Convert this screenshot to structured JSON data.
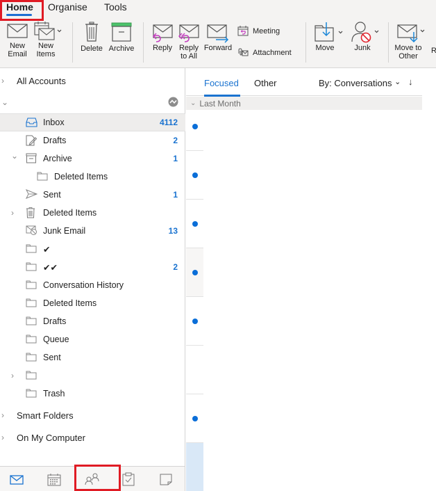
{
  "tabs": [
    {
      "label": "Home",
      "active": true
    },
    {
      "label": "Organise",
      "active": false
    },
    {
      "label": "Tools",
      "active": false
    }
  ],
  "ribbon": {
    "new_email": "New\nEmail",
    "new_email_l1": "New",
    "new_email_l2": "Email",
    "new_items_l1": "New",
    "new_items_l2": "Items",
    "delete": "Delete",
    "archive": "Archive",
    "reply": "Reply",
    "reply_all_l1": "Reply",
    "reply_all_l2": "to All",
    "forward": "Forward",
    "meeting": "Meeting",
    "attachment": "Attachment",
    "move": "Move",
    "junk": "Junk",
    "move_other_l1": "Move to",
    "move_other_l2": "Other",
    "cut_off": "R"
  },
  "sidebar": {
    "all_accounts": "All Accounts",
    "account_name": "",
    "folders": [
      {
        "label": "Inbox",
        "count": "4112",
        "icon": "inbox-icon",
        "selected": true
      },
      {
        "label": "Drafts",
        "count": "2",
        "icon": "drafts-icon"
      },
      {
        "label": "Archive",
        "count": "1",
        "icon": "archive-icon",
        "expanded": true
      },
      {
        "label": "Deleted Items",
        "count": "",
        "icon": "folder-icon",
        "indent": 2
      },
      {
        "label": "Sent",
        "count": "1",
        "icon": "sent-icon"
      },
      {
        "label": "Deleted Items",
        "count": "",
        "icon": "trash-icon",
        "collapsed": true
      },
      {
        "label": "Junk Email",
        "count": "13",
        "icon": "junk-icon"
      },
      {
        "label": "✔",
        "count": "",
        "icon": "folder-icon"
      },
      {
        "label": "✔✔",
        "count": "2",
        "icon": "folder-icon"
      },
      {
        "label": "Conversation History",
        "count": "",
        "icon": "folder-icon"
      },
      {
        "label": "Deleted Items",
        "count": "",
        "icon": "folder-icon"
      },
      {
        "label": "Drafts",
        "count": "",
        "icon": "folder-icon"
      },
      {
        "label": "Queue",
        "count": "",
        "icon": "folder-icon"
      },
      {
        "label": "Sent",
        "count": "",
        "icon": "folder-icon"
      },
      {
        "label": "",
        "count": "",
        "icon": "folder-icon",
        "collapsed": true
      },
      {
        "label": "Trash",
        "count": "",
        "icon": "folder-icon"
      }
    ],
    "smart_folders": "Smart Folders",
    "on_my_computer": "On My Computer"
  },
  "bottom_nav": [
    {
      "name": "mail",
      "active": true
    },
    {
      "name": "calendar"
    },
    {
      "name": "people",
      "highlighted": true
    },
    {
      "name": "tasks"
    },
    {
      "name": "notes"
    }
  ],
  "message_list": {
    "tab_focused": "Focused",
    "tab_other": "Other",
    "sort_label": "By: Conversations",
    "sort_chevron": "⌄",
    "sort_direction": "↓",
    "group_header": "Last Month",
    "rows": [
      {
        "unread": true
      },
      {
        "unread": true
      },
      {
        "unread": true
      },
      {
        "unread": true,
        "hover": true
      },
      {
        "unread": true
      },
      {
        "unread": false
      },
      {
        "unread": true
      },
      {
        "unread": false,
        "selected": true
      }
    ]
  },
  "colors": {
    "accent": "#1a73d0",
    "unread_dot": "#0a6ed8",
    "highlight_box": "#e01b24",
    "reply_icon": "#c43fc0",
    "archive_lid": "#4cc46b",
    "junk_badge": "#e0252f"
  }
}
